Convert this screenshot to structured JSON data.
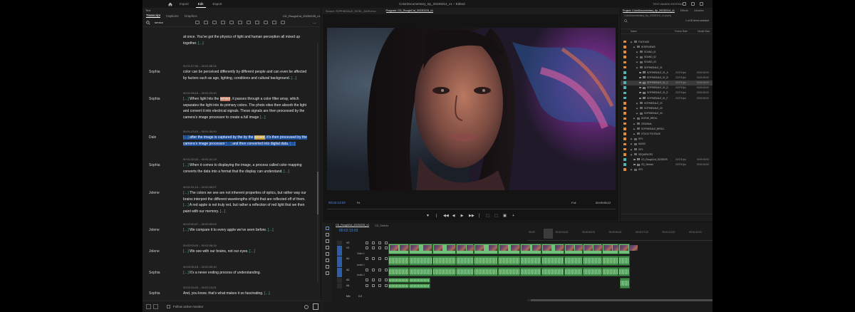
{
  "titlebar": {
    "nav": [
      "Import",
      "Edit",
      "Export"
    ],
    "active": "Edit",
    "title": "ColorDocumentary_6p_20230314_v1  –  Edited",
    "right_label": "TEXT-BASED EDITING"
  },
  "text_panel": {
    "header": "Text",
    "tabs": [
      "Transcript",
      "Captions",
      "Graphics"
    ],
    "active_tab": "Transcript",
    "sequence": "CD_RoughCut_20230225_v1",
    "search_value": "sensor",
    "footer_label": "Follow active monitor",
    "paragraphs": [
      {
        "speaker": "",
        "timecode": "",
        "lines": [
          "at once. You’ve got the physics of light and human perception all mixed up",
          "together. […]"
        ]
      },
      {
        "speaker": "Sophia",
        "timecode": "00:01:07;06 – 00:01:08;16",
        "lines": [
          "color can be perceived differently by different people and can even be affected",
          "by factors such as age, lighting, conditions and cultural background. […]"
        ]
      },
      {
        "speaker": "Sophia",
        "timecode": "00:01:08;18 – 00:01:23;10",
        "lines": [
          "[…] When light hits the sensor, it passes through a color filter array, which",
          "separates the light into its primary colors. The photo sites then absorb the light",
          "and convert it into electrical signals. These signals are then processed by the",
          "camera’s image processor to create a full image […]"
        ]
      },
      {
        "speaker": "Dale",
        "timecode": "00:01:23;10 – 00:01:30;00",
        "lines": [
          "[…] after the image is captured by the by the sensor, it’s then processed by the",
          "camera’s image processor […] and then converted into digital data. […]"
        ]
      },
      {
        "speaker": "Sophia",
        "timecode": "00:01:32;03 – 00:01:41;13",
        "lines": [
          "[…] When it comes to displaying the image, a process called color mapping",
          "converts the data into a format that the display can understand. […]"
        ]
      },
      {
        "speaker": "Jolene",
        "timecode": "00:01:41;14 – 00:02:00;07",
        "lines": [
          "[…] The colors we see are not inherent properties of optics, but rather way our",
          "brains interpret the different wavelengths of light that are reflected off of them.",
          "[…] A red apple is not truly red, but rather a reflection of red light that we then",
          "paint with our memory. […]"
        ]
      },
      {
        "speaker": "Jolene",
        "timecode": "00:02:00;07 – 00:02:03;03",
        "lines": [
          "[…] We compare it to every apple we’ve seen before. […]"
        ]
      },
      {
        "speaker": "Jolene",
        "timecode": "00:02:03;03 – 00:02:06;15",
        "lines": [
          "[…] We see with our brains, not our eyes. […]"
        ]
      },
      {
        "speaker": "Sophia",
        "timecode": "00:02:06;18 – 00:02:09;10",
        "lines": [
          "[…] It’s a never ending process of understanding."
        ]
      },
      {
        "speaker": "Sophia",
        "timecode": "00:02:09;20 – 00:02:13;01",
        "lines": [
          "And, you know, that’s what makes it so fascinating. […]"
        ]
      }
    ]
  },
  "monitor": {
    "source_tab": "Source: SOPHIEDALE_INTEL_A029.mov",
    "program_tab": "Program: CD_RoughCut_20230225_v1",
    "timecode_left": "00:02:13:03",
    "fit": "Fit",
    "resolution": "Full",
    "timecode_right": "00:09:08:12",
    "transport": [
      "▼",
      "❘",
      "◀◀",
      "◀",
      "▶",
      "▶▶",
      "│",
      "⬚",
      "⬚",
      "▣",
      "+"
    ]
  },
  "project": {
    "tabs": [
      "Project: ColorDocumentary_6p_20230314_v1",
      "Effects",
      "Libraries"
    ],
    "subtitle": "ColorDocumentary_6p_20230314_v1.prproj",
    "count": "1 of 30 items selected",
    "columns": [
      "Name",
      "Frame Rate",
      "Media Start"
    ],
    "rows": [
      {
        "indent": 0,
        "name": "FOOTAGE",
        "color": "#e08a3a",
        "fr": "",
        "ms": "",
        "type": "bin",
        "sel": false
      },
      {
        "indent": 1,
        "name": "INTERVIEWS",
        "color": "#e08a3a",
        "fr": "",
        "ms": "",
        "type": "bin",
        "sel": false
      },
      {
        "indent": 2,
        "name": "SOUND_01",
        "color": "#e08a3a",
        "fr": "",
        "ms": "",
        "type": "bin",
        "sel": false
      },
      {
        "indent": 2,
        "name": "SOUND_02",
        "color": "#e08a3a",
        "fr": "",
        "ms": "",
        "type": "bin",
        "sel": false
      },
      {
        "indent": 2,
        "name": "SOUND_03",
        "color": "#e08a3a",
        "fr": "",
        "ms": "",
        "type": "bin",
        "sel": false
      },
      {
        "indent": 2,
        "name": "SOPHIEDALE_01",
        "color": "#e08a3a",
        "fr": "",
        "ms": "",
        "type": "bin",
        "sel": false
      },
      {
        "indent": 3,
        "name": "SOPHIEDALE_01_A",
        "color": "#4fb5b0",
        "fr": "23.976 fps",
        "ms": "00:00:00:00",
        "type": "clip",
        "sel": false
      },
      {
        "indent": 3,
        "name": "SOPHIEDALE_01_B",
        "color": "#4fb5b0",
        "fr": "23.976 fps",
        "ms": "00:00:00:00",
        "type": "clip",
        "sel": false
      },
      {
        "indent": 3,
        "name": "SOPHIEDALE_01_C",
        "color": "#4fb5b0",
        "fr": "23.976 fps",
        "ms": "00:00:00:00",
        "type": "clip",
        "sel": true
      },
      {
        "indent": 3,
        "name": "SOPHIEDALE_01_D",
        "color": "#4fb5b0",
        "fr": "23.976 fps",
        "ms": "00:00:00:00",
        "type": "clip",
        "sel": false
      },
      {
        "indent": 3,
        "name": "SOPHIEDALE_01_E",
        "color": "#4fb5b0",
        "fr": "23.976 fps",
        "ms": "00:00:00:00",
        "type": "clip",
        "sel": false
      },
      {
        "indent": 3,
        "name": "SOPHIEDALE_01_F",
        "color": "#4fb5b0",
        "fr": "23.976 fps",
        "ms": "00:00:00:00",
        "type": "clip",
        "sel": false
      },
      {
        "indent": 2,
        "name": "SOPHIEDALE_02",
        "color": "#e08a3a",
        "fr": "",
        "ms": "",
        "type": "bin",
        "sel": false
      },
      {
        "indent": 2,
        "name": "SOPHIEDALE_03",
        "color": "#e08a3a",
        "fr": "",
        "ms": "",
        "type": "bin",
        "sel": false
      },
      {
        "indent": 2,
        "name": "SOPHIEDALE_04",
        "color": "#e08a3a",
        "fr": "",
        "ms": "",
        "type": "bin",
        "sel": false
      },
      {
        "indent": 1,
        "name": "SCENE_BROLL",
        "color": "#e08a3a",
        "fr": "",
        "ms": "",
        "type": "bin",
        "sel": false
      },
      {
        "indent": 1,
        "name": "ORIGINAL",
        "color": "#e08a3a",
        "fr": "",
        "ms": "",
        "type": "bin",
        "sel": false
      },
      {
        "indent": 1,
        "name": "SOPHIEDALE_BROLL",
        "color": "#e08a3a",
        "fr": "",
        "ms": "",
        "type": "bin",
        "sel": false
      },
      {
        "indent": 1,
        "name": "STOCK FOOTAGE",
        "color": "#e08a3a",
        "fr": "",
        "ms": "",
        "type": "bin",
        "sel": false
      },
      {
        "indent": 0,
        "name": "SFX",
        "color": "#e08a3a",
        "fr": "",
        "ms": "",
        "type": "bin",
        "sel": false
      },
      {
        "indent": 0,
        "name": "MUSIC",
        "color": "#e08a3a",
        "fr": "",
        "ms": "",
        "type": "bin",
        "sel": false
      },
      {
        "indent": 0,
        "name": "GFX",
        "color": "#e08a3a",
        "fr": "",
        "ms": "",
        "type": "bin",
        "sel": false
      },
      {
        "indent": 0,
        "name": "SEQUENCES",
        "color": "#e08a3a",
        "fr": "",
        "ms": "",
        "type": "bin",
        "sel": false
      },
      {
        "indent": 1,
        "name": "CD_RoughCut_20230225",
        "color": "#4fb5b0",
        "fr": "23.976 fps",
        "ms": "00:00:00:00",
        "type": "seq",
        "sel": false
      },
      {
        "indent": 1,
        "name": "CD_Selects",
        "color": "#4fb5b0",
        "fr": "23.976 fps",
        "ms": "00:00:00:00",
        "type": "seq",
        "sel": false
      },
      {
        "indent": 0,
        "name": "VFX",
        "color": "#e08a3a",
        "fr": "",
        "ms": "",
        "type": "bin",
        "sel": false
      }
    ]
  },
  "timeline": {
    "tabs": [
      "CD_RoughCut_20230225_v1",
      "CD_Selects"
    ],
    "timecode": "00:02:13:03",
    "ticks": [
      "00:00",
      "00:00:16:23",
      "00:00:33:23",
      "00:00:50:22",
      "00:01:07:22",
      "00:01:24:22",
      "00:01:41:21",
      "00:01:58:21",
      "00:02:15:20",
      "00:02:32:20"
    ],
    "tracks": [
      {
        "name": "V2",
        "label": ""
      },
      {
        "name": "V1",
        "label": "Video 1"
      },
      {
        "name": "A1",
        "label": "Audio 1"
      },
      {
        "name": "A2",
        "label": "Audio 2"
      },
      {
        "name": "A3",
        "label": ""
      },
      {
        "name": "A4",
        "label": ""
      }
    ],
    "mix_label": "Mix",
    "mix_value": "0.0"
  },
  "colors": {
    "accent_blue": "#3f8cff",
    "clip_green": "#6fc07a",
    "label_orange": "#e08a3a",
    "label_teal": "#4fb5b0",
    "search_highlight": "#c97f66",
    "selection_highlight": "#1f4f9a"
  }
}
